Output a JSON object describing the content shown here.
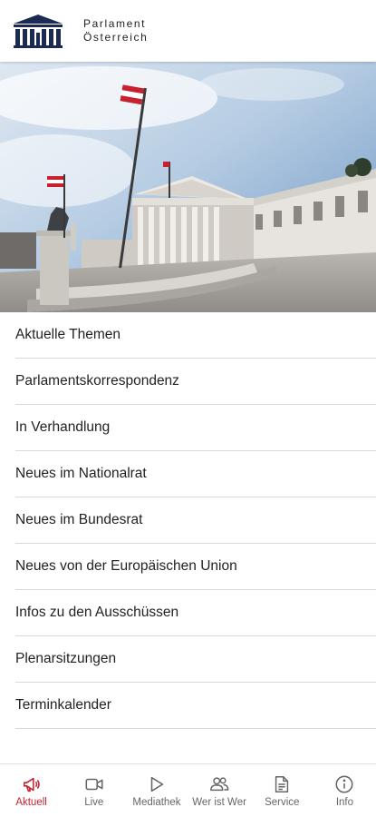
{
  "header": {
    "brand_line1": "Parlament",
    "brand_line2": "Österreich",
    "logo_icon": "parliament-building-logo"
  },
  "hero": {
    "image": "parliament-building-photo"
  },
  "menu": {
    "items": [
      {
        "label": "Aktuelle Themen"
      },
      {
        "label": "Parlamentskorrespondenz"
      },
      {
        "label": "In Verhandlung"
      },
      {
        "label": "Neues im Nationalrat"
      },
      {
        "label": "Neues im Bundesrat"
      },
      {
        "label": "Neues von der Europäischen Union"
      },
      {
        "label": "Infos zu den Ausschüssen"
      },
      {
        "label": "Plenarsitzungen"
      },
      {
        "label": "Terminkalender"
      }
    ]
  },
  "tabbar": {
    "active": "Aktuell",
    "active_color": "#c8202f",
    "tabs": [
      {
        "label": "Aktuell",
        "icon": "megaphone-icon"
      },
      {
        "label": "Live",
        "icon": "video-camera-icon"
      },
      {
        "label": "Mediathek",
        "icon": "play-icon"
      },
      {
        "label": "Wer ist Wer",
        "icon": "people-icon"
      },
      {
        "label": "Service",
        "icon": "document-icon"
      },
      {
        "label": "Info",
        "icon": "info-icon"
      }
    ]
  }
}
